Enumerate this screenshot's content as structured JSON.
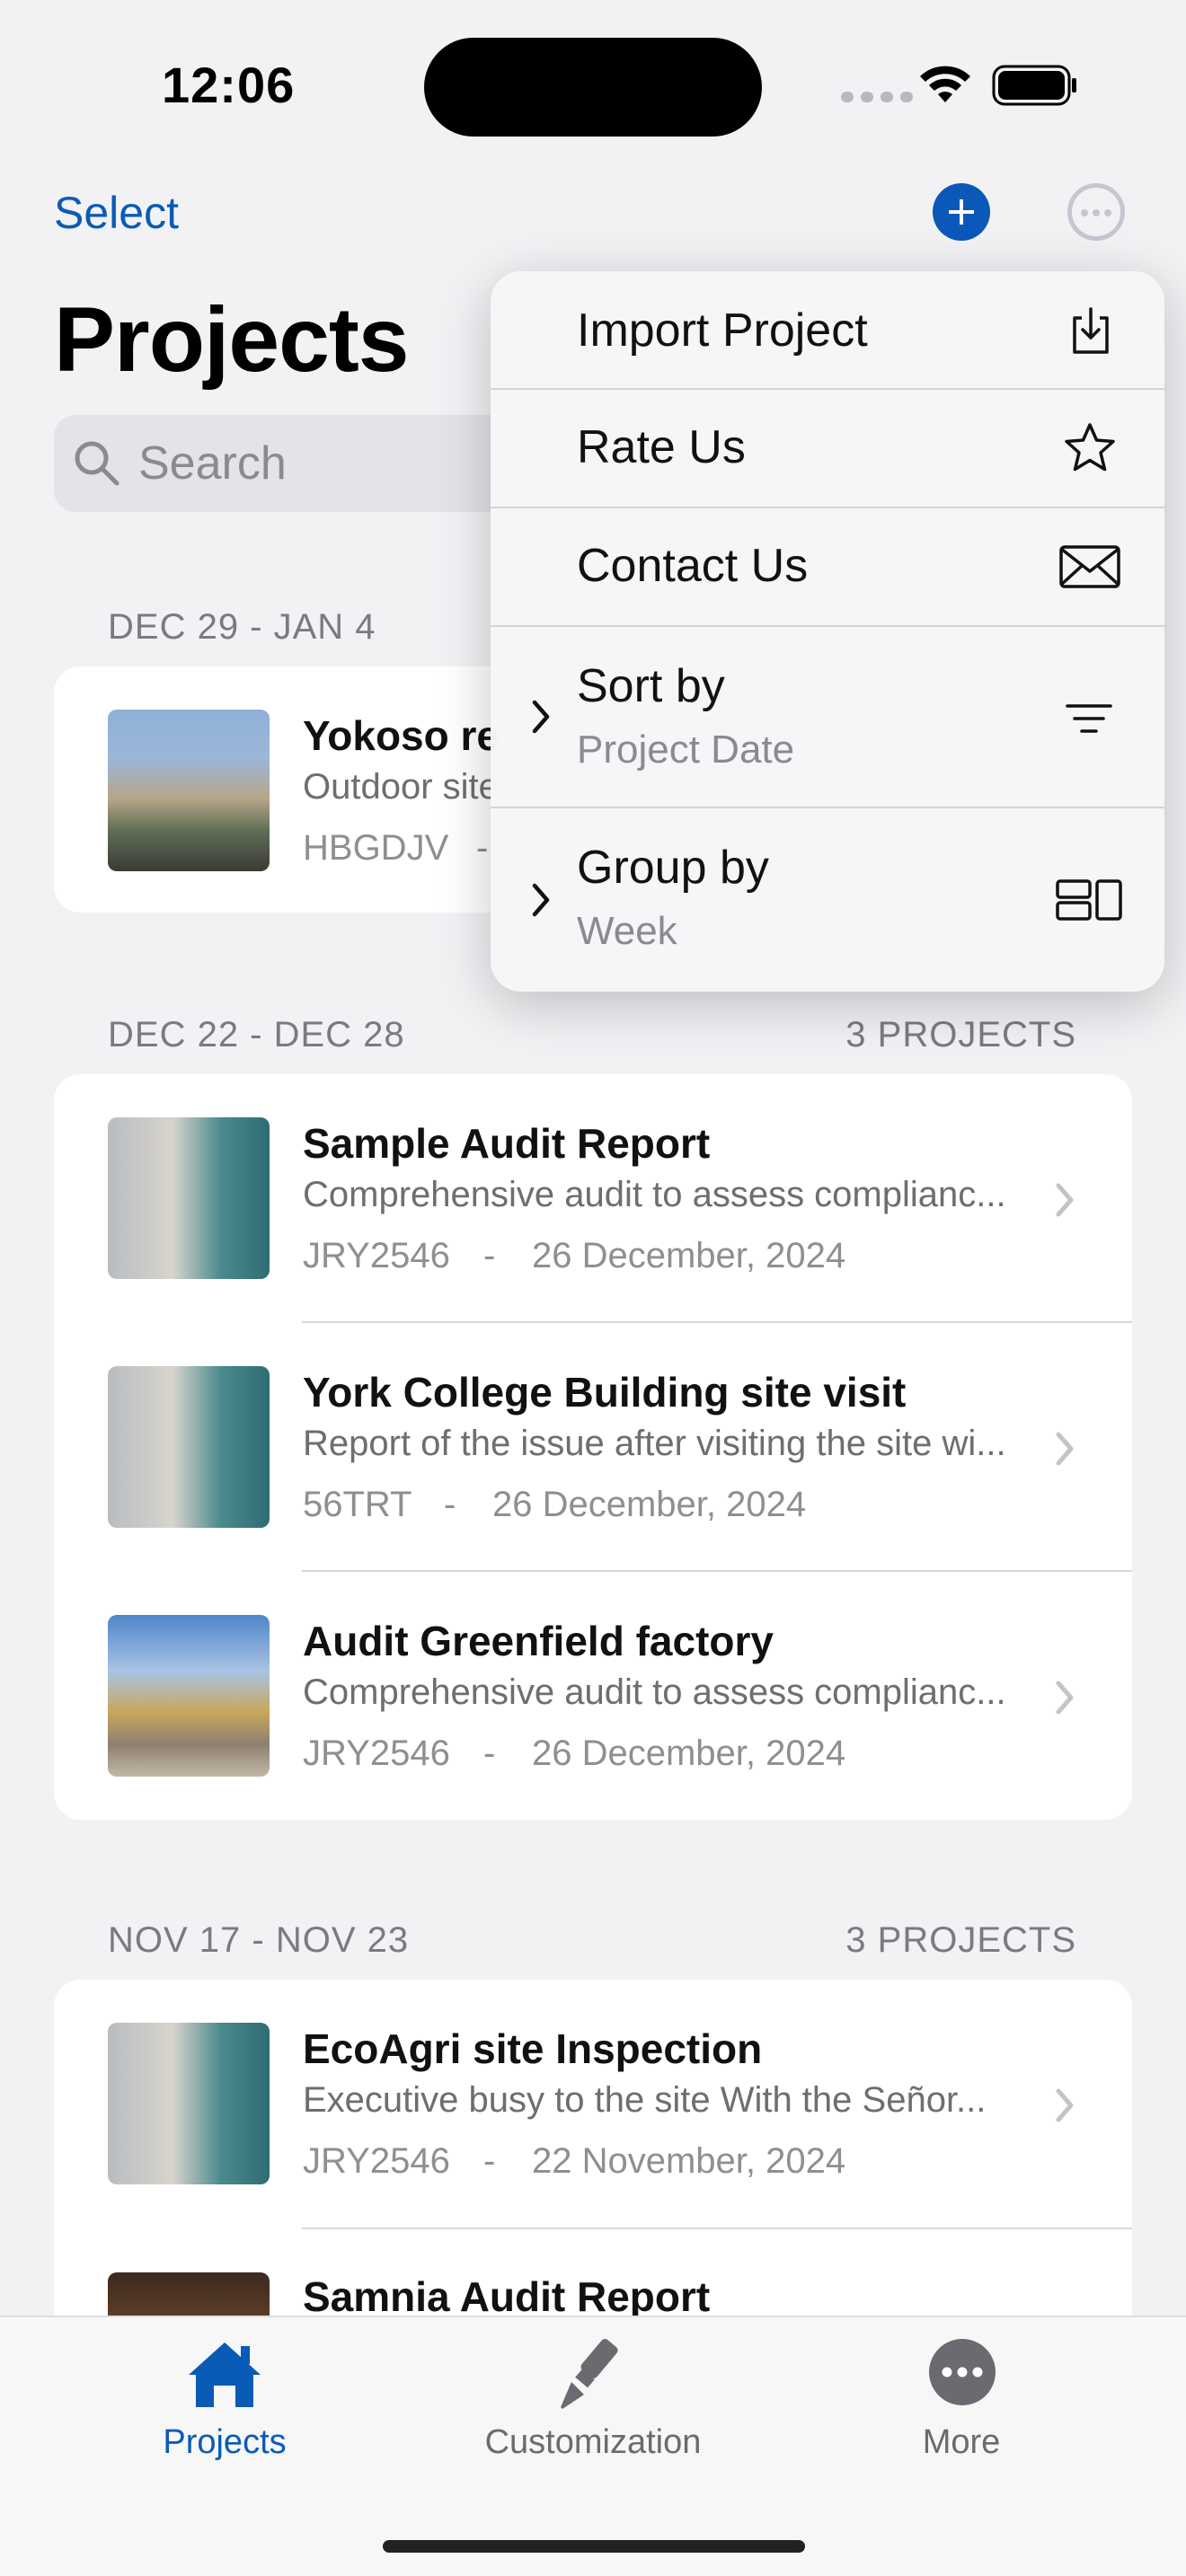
{
  "status": {
    "time": "12:06"
  },
  "nav": {
    "select_label": "Select",
    "title": "Projects"
  },
  "search": {
    "placeholder": "Search"
  },
  "colors": {
    "accent": "#0a5bb5",
    "background": "#f2f2f5"
  },
  "menu": {
    "items": [
      {
        "label": "Import Project",
        "icon": "import-icon"
      },
      {
        "label": "Rate Us",
        "icon": "star-icon"
      },
      {
        "label": "Contact Us",
        "icon": "envelope-icon"
      },
      {
        "label": "Sort by",
        "sub": "Project Date",
        "icon": "sort-lines-icon"
      },
      {
        "label": "Group by",
        "sub": "Week",
        "icon": "group-layout-icon"
      }
    ]
  },
  "sections": [
    {
      "header": "DEC 29 - JAN 4",
      "rows": [
        {
          "title": "Yokoso re",
          "desc": "Outdoor site",
          "code": "HBGDJV",
          "sep": "-"
        }
      ]
    },
    {
      "header": "DEC 22 - DEC 28",
      "count": "3 PROJECTS",
      "rows": [
        {
          "title": "Sample Audit Report",
          "desc": "Comprehensive audit to assess complianc...",
          "code": "JRY2546",
          "sep": "-",
          "date": "26 December, 2024"
        },
        {
          "title": "York College Building site visit",
          "desc": "Report of the issue after visiting the site wi...",
          "code": "56TRT",
          "sep": "-",
          "date": "26 December, 2024"
        },
        {
          "title": "Audit Greenfield factory",
          "desc": "Comprehensive audit to assess complianc...",
          "code": "JRY2546",
          "sep": "-",
          "date": "26 December, 2024"
        }
      ]
    },
    {
      "header": "NOV 17 - NOV 23",
      "count": "3 PROJECTS",
      "rows": [
        {
          "title": "EcoAgri site Inspection",
          "desc": "Executive busy to the site With the Señor...",
          "code": "JRY2546",
          "sep": "-",
          "date": "22 November, 2024"
        },
        {
          "title": "Samnia Audit Report"
        }
      ]
    }
  ],
  "tabs": [
    {
      "label": "Projects",
      "icon": "house-icon",
      "active": true
    },
    {
      "label": "Customization",
      "icon": "paintbrush-icon"
    },
    {
      "label": "More",
      "icon": "more-dots-icon"
    }
  ]
}
